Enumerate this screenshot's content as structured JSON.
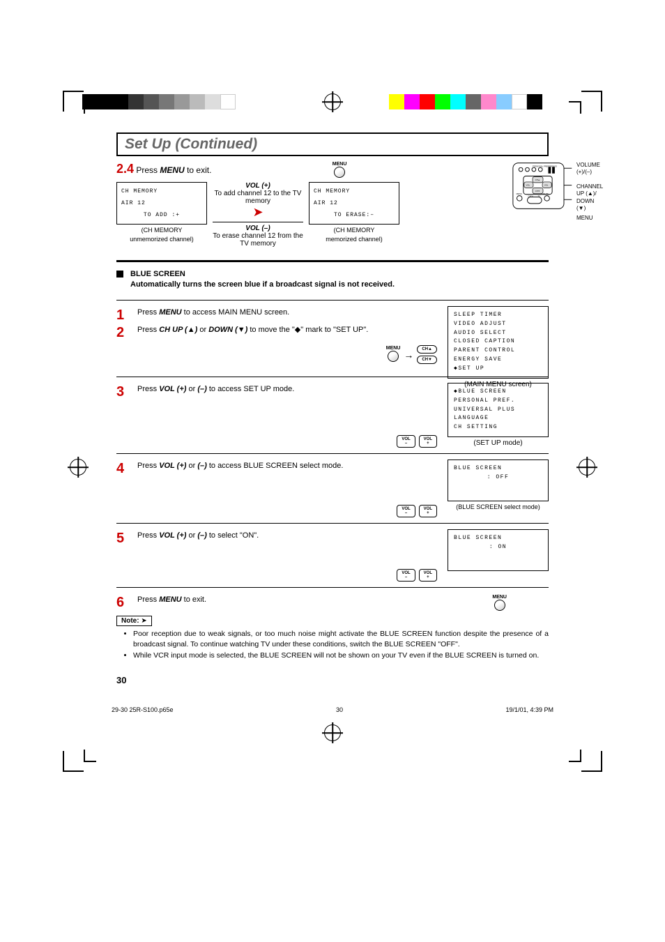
{
  "title": "Set Up (Continued)",
  "s24": {
    "num": "2.4",
    "text_a": " Press ",
    "menu": "MENU",
    "text_b": " to exit.",
    "osd_left": {
      "l1": "CH MEMORY",
      "l2": "AIR 12",
      "l3": "TO ADD  :+"
    },
    "osd_left_cap1": "(CH MEMORY",
    "osd_left_cap2": "unmemorized channel)",
    "vol_plus_title": "VOL (+)",
    "vol_plus_text": "To add channel 12 to the TV memory",
    "vol_minus_title": "VOL (–)",
    "vol_minus_text": "To erase channel 12 from the TV memory",
    "osd_right": {
      "l1": "CH MEMORY",
      "l2": "AIR 12",
      "l3": "TO ERASE:–"
    },
    "osd_right_cap1": "(CH MEMORY",
    "osd_right_cap2": "memorized channel)",
    "menu_icon": "MENU"
  },
  "remote": {
    "volume": "VOLUME",
    "volume_sub": "(+)/(–)",
    "channel": "CHANNEL",
    "channel_sub1": "UP (▲)/",
    "channel_sub2": "DOWN (▼)",
    "menu": "MENU",
    "pp": "PERSONAL PREFERENCE",
    "b_ch": "CH▲",
    "b_vol": "VOL",
    "b_chd": "CH▼",
    "b_menu": "MENU",
    "b_mute": "MUTE",
    "b_catv": "CATV",
    "b_tv": "TV"
  },
  "blue_screen": {
    "title": "BLUE SCREEN",
    "desc": "Automatically turns the screen blue if a broadcast signal is not received."
  },
  "step1": {
    "num": "1",
    "a": "Press ",
    "m": "MENU",
    "b": " to access MAIN MENU screen."
  },
  "step2": {
    "num": "2",
    "a": "Press ",
    "chup": "CH UP (▲)",
    "or": " or ",
    "chdown": "DOWN (▼)",
    "b": " to move the \"",
    "sym": "◆",
    "c": "\" mark to \"SET UP\".",
    "menu_icon": "MENU",
    "btn_cha": "CH▲",
    "btn_chv": "CH▼",
    "osd": {
      "l1": "SLEEP TIMER",
      "l2": "VIDEO ADJUST",
      "l3": "AUDIO SELECT",
      "l4": "CLOSED CAPTION",
      "l5": "PARENT CONTROL",
      "l6": "ENERGY SAVE",
      "l7": "◆SET UP"
    },
    "osd_cap": "(MAIN MENU screen)"
  },
  "step3": {
    "num": "3",
    "a": "Press ",
    "vp": "VOL (+)",
    "or": " or ",
    "vm": "(–)",
    "b": " to access SET UP mode.",
    "btn_volm": "VOL\n–",
    "btn_volp": "VOL\n+",
    "osd": {
      "l1": "◆BLUE SCREEN",
      "l2": " PERSONAL PREF.",
      "l3": " UNIVERSAL PLUS",
      "l4": " LANGUAGE",
      "l5": " CH SETTING"
    },
    "osd_cap": "(SET UP mode)"
  },
  "step4": {
    "num": "4",
    "a": "Press ",
    "vp": "VOL (+)",
    "or": " or ",
    "vm": "(–)",
    "b": " to access BLUE SCREEN select mode.",
    "osd": {
      "l1": "BLUE SCREEN",
      "l2": ": OFF"
    },
    "osd_cap": "(BLUE SCREEN select mode)"
  },
  "step5": {
    "num": "5",
    "a": "Press ",
    "vp": "VOL (+)",
    "or": " or ",
    "vm": "(–)",
    "b": " to select \"ON\".",
    "osd": {
      "l1": "BLUE SCREEN",
      "l2": ": ON"
    }
  },
  "step6": {
    "num": "6",
    "a": "Press ",
    "m": "MENU",
    "b": " to exit.",
    "menu_icon": "MENU"
  },
  "note": {
    "label": "Note:",
    "n1": "Poor reception due to weak signals, or too much noise might activate the BLUE SCREEN function despite the presence of a broadcast signal. To continue watching TV under these conditions, switch the BLUE SCREEN \"OFF\".",
    "n2": "While VCR input mode is selected, the BLUE SCREEN will not be shown on your TV even if the BLUE SCREEN is turned on."
  },
  "page_num": "30",
  "footer": {
    "file": "29-30 25R-S100.p65e",
    "page": "30",
    "date": "19/1/01, 4:39 PM"
  },
  "colors": {
    "bars_bw": [
      "#000",
      "#000",
      "#000",
      "#333",
      "#555",
      "#777",
      "#999",
      "#bbb",
      "#ddd",
      "#fff"
    ],
    "bars_color": [
      "#0ff",
      "#ff0",
      "#f0f",
      "#f00",
      "#0f0",
      "#00f",
      "#888",
      "#f8c",
      "#8cf",
      "#000"
    ]
  }
}
